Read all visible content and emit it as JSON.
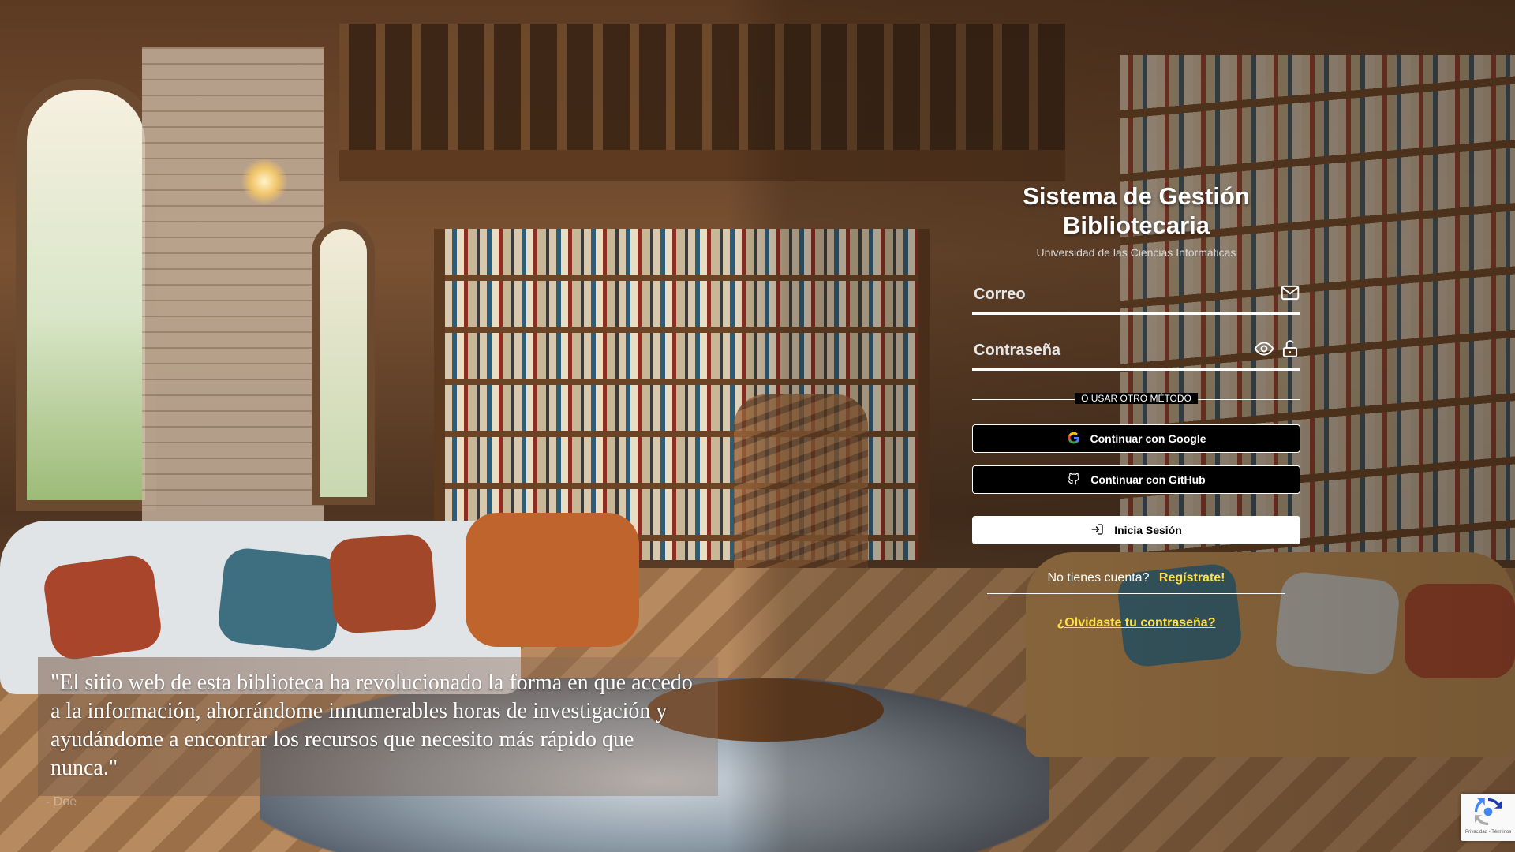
{
  "login": {
    "title_line1": "Sistema de Gestión",
    "title_line2": "Bibliotecaria",
    "subtitle": "Universidad de las Ciencias Informáticas",
    "email_placeholder": "Correo",
    "password_placeholder": "Contraseña",
    "separator": "O USAR OTRO MÉTODO",
    "google_button": "Continuar con Google",
    "github_button": "Continuar con GitHub",
    "login_button": "Inicia Sesión",
    "no_account": "No tienes cuenta?",
    "register_link": "Regístrate!",
    "forgot_link": "¿Olvidaste tu contraseña?"
  },
  "testimonial": {
    "quote": "\"El sitio web de esta biblioteca ha revolucionado la forma en que accedo a la información, ahorrándome innumerables horas de investigación y ayudándome a encontrar los recursos que necesito más rápido que nunca.\"",
    "author": "- Doe"
  },
  "recaptcha": {
    "text": "Privacidad - Términos"
  },
  "colors": {
    "accent": "#ffe047",
    "button_dark": "#000000",
    "button_light": "#ffffff"
  },
  "icons": [
    "mail-icon",
    "eye-icon",
    "unlock-icon",
    "google-icon",
    "github-icon",
    "login-icon",
    "recaptcha-icon"
  ]
}
